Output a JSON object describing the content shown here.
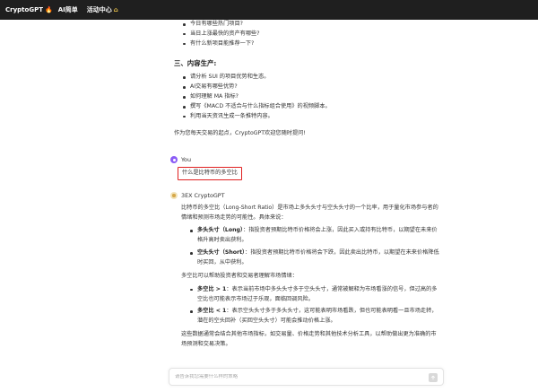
{
  "topbar": {
    "brand": "CryptoGPT",
    "nav": [
      "AI简单",
      "活动中心"
    ]
  },
  "prev_answer": {
    "top_items": [
      "今日有哪些热门项目?",
      "当日上涨最快的资产有哪些?",
      "有什么新项目能推荐一下?"
    ],
    "section_title": "三、内容生产:",
    "section_items": [
      "请分析 SUI 的项目优势和生态。",
      "AI交易有哪些优势?",
      "如何理解 MA 指标?",
      "撰写《MACD 不适合与什么指标组合使用》的视频脚本。",
      "利用当天资讯生成一条推特内容。"
    ],
    "closing": "作为您每天交易的起点，CryptoGPT欢迎您随时提问!"
  },
  "user_message": {
    "name": "You",
    "text": "什么是比特币的多空比"
  },
  "bot_message": {
    "name": "3EX CryptoGPT",
    "intro": "比特币的多空比（Long-Short Ratio）是市场上多头头寸与空头头寸的一个比率，用于量化市场参与者的情绪和预测市场走势的可能性。具体来说：",
    "defs": [
      {
        "term": "多头头寸（Long）",
        "desc": "：指投资者预期比特币价格将会上涨，因此买入或持有比特币，以期望在未来价格升高时卖出获利。"
      },
      {
        "term": "空头头寸（Short）",
        "desc": "：指投资者预期比特币价格将会下跌，因此卖出比特币，以期望在未来价格降低时买回，从中获利。"
      }
    ],
    "middle": "多空比可以帮助投资者和交易者理解市场情绪：",
    "ratios": [
      {
        "term": "多空比 > 1",
        "desc": "：表示当前市场中多头头寸多于空头头寸，通常被解释为市场看涨的信号，但过高的多空比也可能表示市场过于乐观，面临回调风险。"
      },
      {
        "term": "多空比 < 1",
        "desc": "：表示空头头寸多于多头头寸，这可能表明市场看跌，但也可能表明看一旦市场走转，潜在的空头回补（买回空头头寸）可能会推动价格上涨。"
      }
    ],
    "outro": "这些数据通常会结合其他市场指标，如交易量、价格走势和其他技术分析工具，以帮助做出更为准确的市场预测和交易决策。"
  },
  "composer": {
    "placeholder": "请告诉我您需要什么样的策略"
  }
}
